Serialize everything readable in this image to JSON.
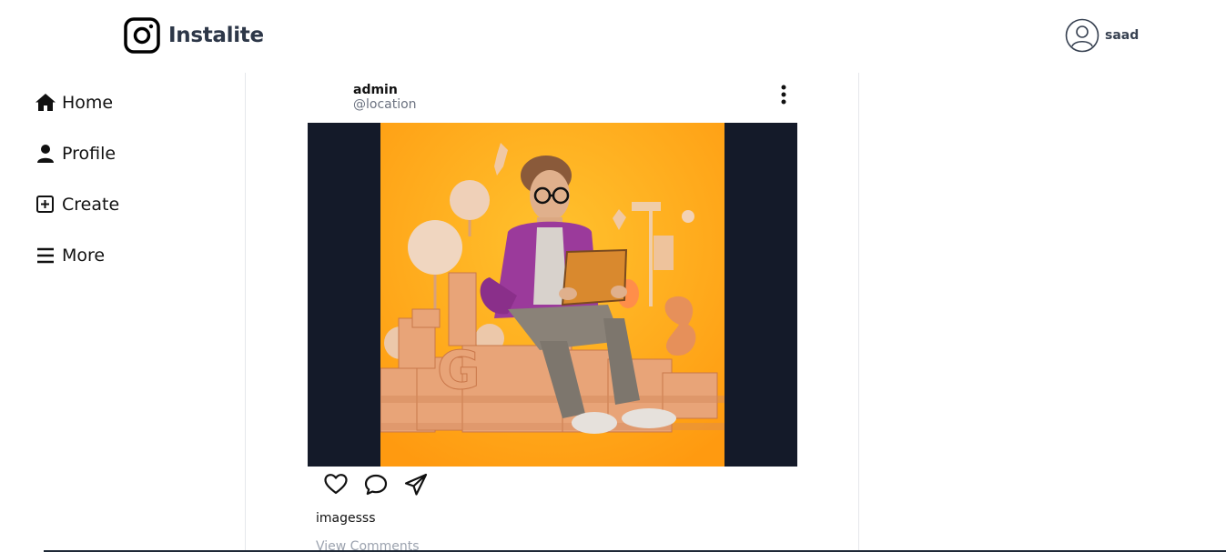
{
  "header": {
    "app_name": "Instalite",
    "logo_icon": "instagram-logo-icon",
    "user": {
      "username": "saad",
      "avatar_icon": "user-circle-icon"
    }
  },
  "sidebar": {
    "items": [
      {
        "label": "Home",
        "icon": "home-icon"
      },
      {
        "label": "Profile",
        "icon": "user-icon"
      },
      {
        "label": "Create",
        "icon": "plus-square-icon"
      },
      {
        "label": "More",
        "icon": "menu-icon"
      }
    ]
  },
  "post": {
    "username": "admin",
    "location": "@location",
    "menu_icon": "more-vertical-icon",
    "image_alt": "3D illustration of a man in a purple jacket with a laptop on orange background",
    "actions": [
      {
        "name": "like",
        "icon": "heart-icon"
      },
      {
        "name": "comment",
        "icon": "comment-icon"
      },
      {
        "name": "share",
        "icon": "send-icon"
      }
    ],
    "caption": "imagesss",
    "view_comments_label": "View Comments"
  },
  "colors": {
    "brand_text": "#2d3748",
    "media_background": "#141a29",
    "image_orange": "#ffa51a",
    "muted_text": "#6b7280",
    "divider": "#e5e7eb"
  }
}
